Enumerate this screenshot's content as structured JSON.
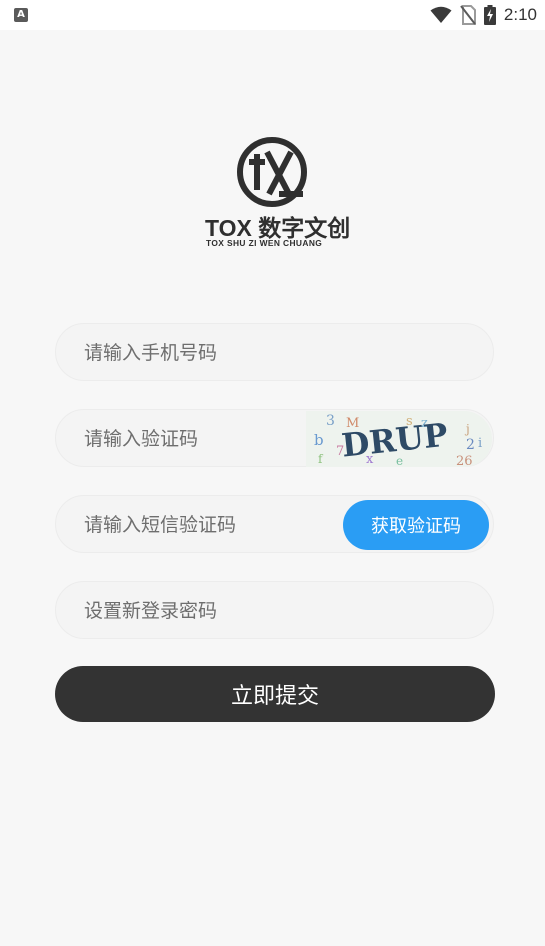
{
  "status_bar": {
    "time": "2:10",
    "app_icon_letter": "A",
    "icons": [
      "wifi-icon",
      "no-sim-icon",
      "battery-charging-icon"
    ]
  },
  "brand": {
    "name": "TOX 数字文创",
    "subtitle": "TOX SHU ZI WEN CHUANG"
  },
  "form": {
    "phone_placeholder": "请输入手机号码",
    "captcha_placeholder": "请输入验证码",
    "captcha_image_text": "DRUP",
    "sms_placeholder": "请输入短信验证码",
    "sms_button_label": "获取验证码",
    "password_placeholder": "设置新登录密码",
    "submit_label": "立即提交"
  },
  "colors": {
    "accent": "#2a9df4",
    "submit": "#333333",
    "background": "#f7f7f7"
  }
}
